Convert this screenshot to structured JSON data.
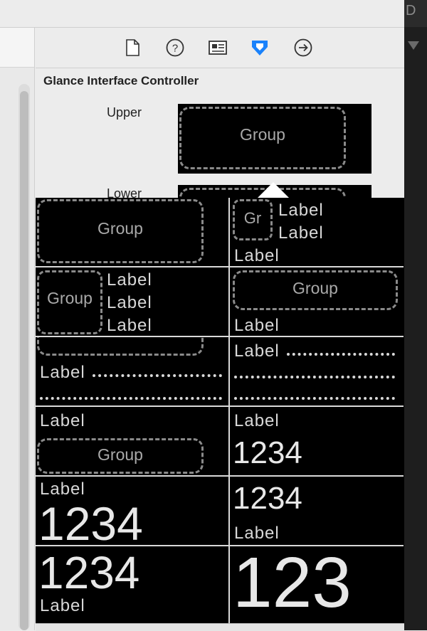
{
  "window": {
    "corner_letter": "D"
  },
  "inspector": {
    "toolbar_icons": [
      "file-icon",
      "help-icon",
      "identity-icon",
      "attributes-icon",
      "connections-icon"
    ],
    "section_title": "Glance Interface Controller",
    "upper_label": "Upper",
    "lower_label": "Lower",
    "upper_group_text": "Group"
  },
  "popover": {
    "templates": [
      {
        "col": 0,
        "group": "Group"
      },
      {
        "col": 1,
        "group": "Gr",
        "labels": [
          "Label",
          "Label"
        ],
        "bottom": "Label"
      },
      {
        "col": 0,
        "group": "Group",
        "labels": [
          "Label",
          "Label",
          "Label"
        ]
      },
      {
        "col": 1,
        "group": "Group",
        "bottom": "Label"
      },
      {
        "col": 0,
        "label": "Label"
      },
      {
        "col": 1,
        "label": "Label"
      },
      {
        "col": 0,
        "top": "Label",
        "group": "Group"
      },
      {
        "col": 1,
        "top": "Label",
        "number": "1234"
      },
      {
        "col": 0,
        "top": "Label",
        "number": "1234"
      },
      {
        "col": 1,
        "number": "1234",
        "bottom": "Label"
      },
      {
        "col": 0,
        "number": "1234",
        "bottom": "Label"
      },
      {
        "col": 1,
        "number": "123"
      }
    ]
  },
  "colors": {
    "accent": "#1a82fb",
    "preview_bg": "#000000",
    "group_border": "#8a8a8a"
  }
}
